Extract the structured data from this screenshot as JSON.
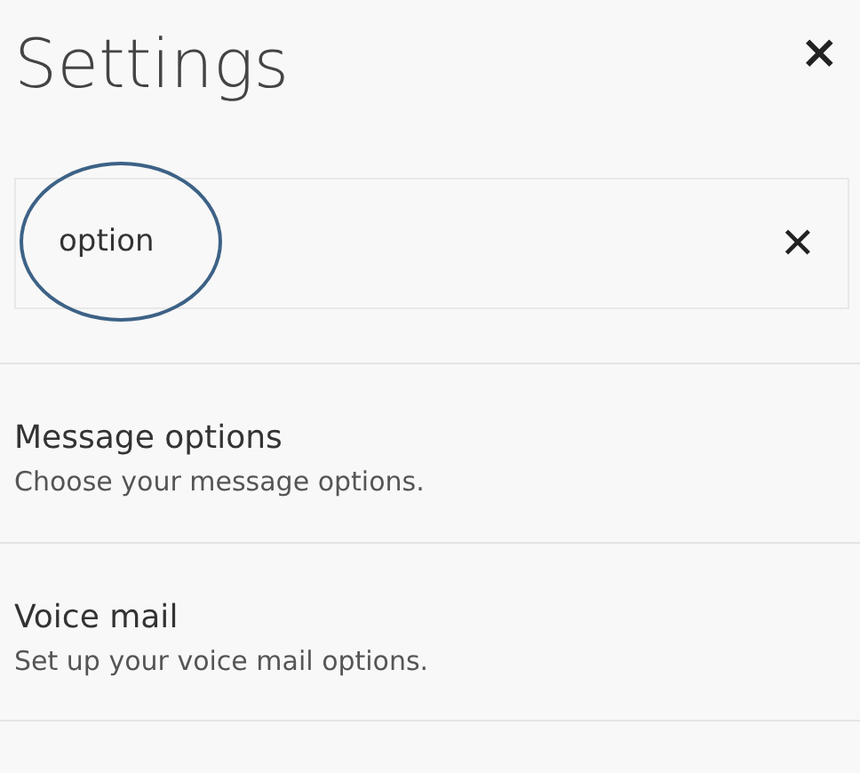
{
  "title": "Settings",
  "close": "×",
  "search": {
    "value": "option",
    "clear": "✕"
  },
  "results": [
    {
      "title": "Message options",
      "description": "Choose your message options."
    },
    {
      "title": "Voice mail",
      "description": "Set up your voice mail options."
    }
  ]
}
